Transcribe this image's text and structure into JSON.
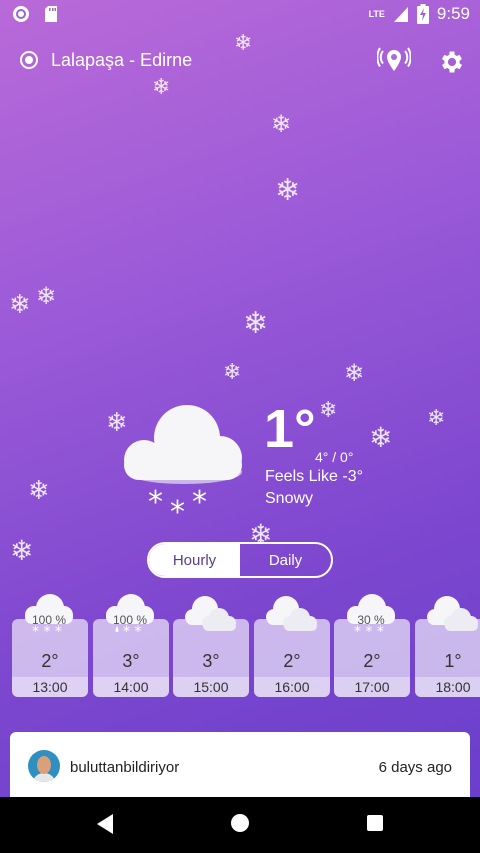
{
  "status_bar": {
    "time": "9:59",
    "network": "LTE",
    "icons": [
      "notification-circle-icon",
      "sd-card-icon",
      "signal-icon",
      "battery-charging-icon"
    ]
  },
  "header": {
    "location": "Lalapaşa - Edirne",
    "icons": [
      "radio-selected-icon",
      "location-signal-icon",
      "gear-icon"
    ]
  },
  "current": {
    "temperature": "1°",
    "range": "4° / 0°",
    "feels_like": "Feels Like -3°",
    "condition": "Snowy",
    "icon": "snow-cloud-icon"
  },
  "toggle": {
    "hourly_label": "Hourly",
    "daily_label": "Daily",
    "selected": "Hourly"
  },
  "hourly": [
    {
      "time": "13:00",
      "temp": "2°",
      "precip": "100 %",
      "icon": "snow-cloud-icon"
    },
    {
      "time": "14:00",
      "temp": "3°",
      "precip": "100 %",
      "icon": "sleet-cloud-icon"
    },
    {
      "time": "15:00",
      "temp": "3°",
      "precip": "",
      "icon": "overcast-cloud-icon"
    },
    {
      "time": "16:00",
      "temp": "2°",
      "precip": "",
      "icon": "overcast-cloud-icon"
    },
    {
      "time": "17:00",
      "temp": "2°",
      "precip": "30 %",
      "icon": "snow-cloud-icon"
    },
    {
      "time": "18:00",
      "temp": "1°",
      "precip": "",
      "icon": "overcast-cloud-icon"
    }
  ],
  "post": {
    "username": "buluttanbildiriyor",
    "time_ago": "6 days ago"
  },
  "colors": {
    "gradient_top": "#b96ad8",
    "gradient_bottom": "#6a3fcc",
    "toggle_text": "#5a3c8a"
  }
}
